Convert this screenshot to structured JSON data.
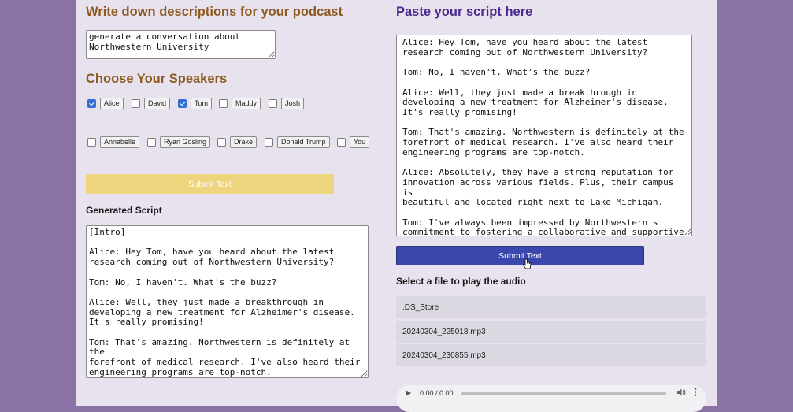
{
  "left": {
    "title": "Write down descriptions for your podcast",
    "description_value": "generate a conversation about\nNorthwestern University",
    "speakers_title": "Choose Your Speakers",
    "speakers": [
      {
        "name": "Alice",
        "checked": true
      },
      {
        "name": "David",
        "checked": false
      },
      {
        "name": "Tom",
        "checked": true
      },
      {
        "name": "Maddy",
        "checked": false
      },
      {
        "name": "Josh",
        "checked": false
      },
      {
        "name": "Annabelle",
        "checked": false
      },
      {
        "name": "Ryan Gosling",
        "checked": false
      },
      {
        "name": "Drake",
        "checked": false
      },
      {
        "name": "Donald Trump",
        "checked": false
      },
      {
        "name": "You",
        "checked": false
      }
    ],
    "submit_label": "Submit Text",
    "submit_color": "#efd47e",
    "generated_label": "Generated Script",
    "generated_value": "[Intro]\n\nAlice: Hey Tom, have you heard about the latest\nresearch coming out of Northwestern University?\n\nTom: No, I haven't. What's the buzz?\n\nAlice: Well, they just made a breakthrough in\ndeveloping a new treatment for Alzheimer's disease.\nIt's really promising!\n\nTom: That's amazing. Northwestern is definitely at the\nforefront of medical research. I've also heard their\nengineering programs are top-notch."
  },
  "right": {
    "title": "Paste your script here",
    "script_value": "Alice: Hey Tom, have you heard about the latest\nresearch coming out of Northwestern University?\n\nTom: No, I haven't. What's the buzz?\n\nAlice: Well, they just made a breakthrough in\ndeveloping a new treatment for Alzheimer's disease.\nIt's really promising!\n\nTom: That's amazing. Northwestern is definitely at the\nforefront of medical research. I've also heard their\nengineering programs are top-notch.\n\nAlice: Absolutely, they have a strong reputation for\ninnovation across various fields. Plus, their campus is\nbeautiful and located right next to Lake Michigan.\n\nTom: I've always been impressed by Northwestern's\ncommitment to fostering a collaborative and supportive\nenvironment for students and researchers alike.",
    "submit_label": "Submit Text",
    "submit_color": "#3a48ad",
    "file_label": "Select a file to play the audio",
    "files": [
      ".DS_Store",
      "20240304_225018.mp3",
      "20240304_230855.mp3"
    ],
    "audio_time": "0:00 / 0:00"
  },
  "colors": {
    "background": "#8b72a6",
    "panel": "#e7e2ed",
    "left_heading": "#8d5a1f",
    "right_heading": "#4d2a8f"
  },
  "icons": [
    "play-icon",
    "volume-icon",
    "more-options-icon",
    "pointer-cursor-icon"
  ]
}
